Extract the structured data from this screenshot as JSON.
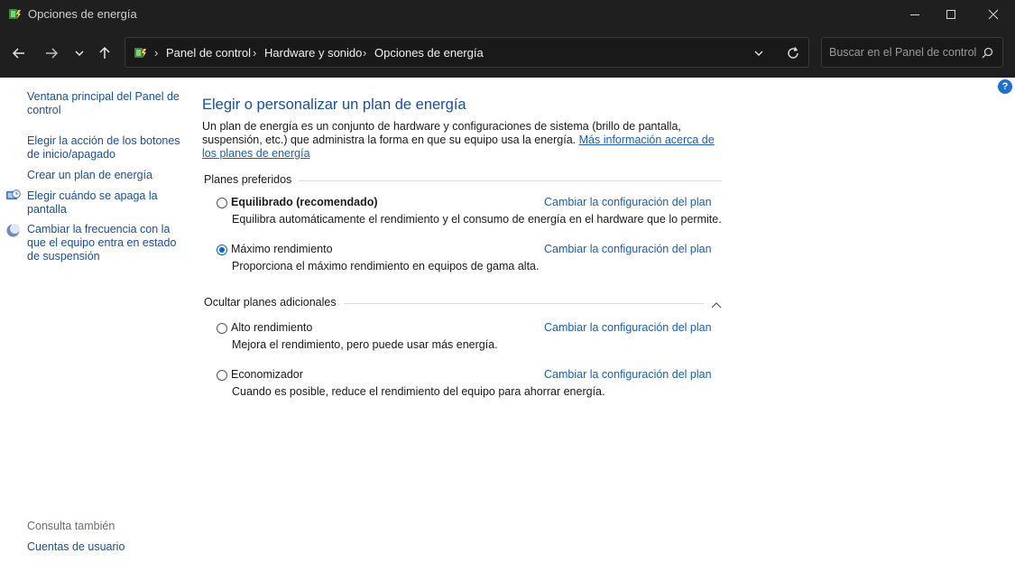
{
  "window": {
    "title": "Opciones de energía"
  },
  "address": {
    "crumbs": [
      "Panel de control",
      "Hardware y sonido",
      "Opciones de energía"
    ]
  },
  "search": {
    "placeholder": "Buscar en el Panel de control"
  },
  "sidebar": {
    "items": [
      {
        "label": "Ventana principal del Panel de control",
        "icon": null
      },
      {
        "label": "Elegir la acción de los botones de inicio/apagado",
        "icon": null
      },
      {
        "label": "Crear un plan de energía",
        "icon": null
      },
      {
        "label": "Elegir cuándo se apaga la pantalla",
        "icon": "monitor-clock-icon"
      },
      {
        "label": "Cambiar la frecuencia con la que el equipo entra en estado de suspensión",
        "icon": "sleep-moon-icon"
      }
    ],
    "see_also_label": "Consulta también",
    "see_also_items": [
      "Cuentas de usuario"
    ]
  },
  "main": {
    "title": "Elegir o personalizar un plan de energía",
    "intro_text": "Un plan de energía es un conjunto de hardware y configuraciones de sistema (brillo de pantalla, suspensión, etc.) que administra la forma en que su equipo usa la energía.",
    "intro_link": "Más información acerca de los planes de energía",
    "preferred_label": "Planes preferidos",
    "preferred_plans": [
      {
        "name": "Equilibrado (recomendado)",
        "bold": true,
        "selected": false,
        "description": "Equilibra automáticamente el rendimiento y el consumo de energía en el hardware que lo permite.",
        "link": "Cambiar la configuración del plan"
      },
      {
        "name": "Máximo rendimiento",
        "bold": false,
        "selected": true,
        "description": "Proporciona el máximo rendimiento en equipos de gama alta.",
        "link": "Cambiar la configuración del plan"
      }
    ],
    "additional_label": "Ocultar planes adicionales",
    "additional_plans": [
      {
        "name": "Alto rendimiento",
        "bold": false,
        "selected": false,
        "description": "Mejora el rendimiento, pero puede usar más energía.",
        "link": "Cambiar la configuración del plan"
      },
      {
        "name": "Economizador",
        "bold": false,
        "selected": false,
        "description": "Cuando es posible, reduce el rendimiento del equipo para ahorrar energía.",
        "link": "Cambiar la configuración del plan"
      }
    ],
    "help_glyph": "?"
  },
  "colors": {
    "titlebar_bg": "#1f1f1f",
    "link_blue": "#1a5fb4",
    "heading_blue": "#1a4e9e",
    "radio_accent": "#0067c0"
  }
}
